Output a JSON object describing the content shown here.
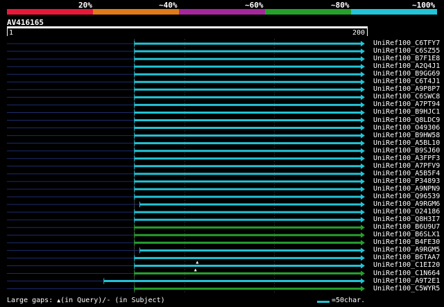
{
  "scale": {
    "colors": [
      "#e51a3a",
      "#e07b1b",
      "#a6279c",
      "#25a02c",
      "#22c4d6"
    ],
    "labels": [
      "20%",
      "~40%",
      "~60%",
      "~80%",
      "~100%"
    ]
  },
  "query": {
    "name": "AV416165",
    "range_start": "1",
    "range_end": "200"
  },
  "colors": {
    "high": "#22c4d6",
    "mid": "#25a02c",
    "guide": "#1c2d6e",
    "gridline": "#2a2a2a"
  },
  "chart_data": {
    "type": "alignment",
    "x_range": [
      1,
      200
    ],
    "hits": [
      {
        "name": "UniRef100_C6TFY7",
        "start": 72,
        "end": 200,
        "color": "high"
      },
      {
        "name": "UniRef100_C6SZ55",
        "start": 72,
        "end": 200,
        "color": "high"
      },
      {
        "name": "UniRef100_B7F1E8",
        "start": 72,
        "end": 200,
        "color": "high"
      },
      {
        "name": "UniRef100_A2Q4J1",
        "start": 72,
        "end": 200,
        "color": "high"
      },
      {
        "name": "UniRef100_B9GG69",
        "start": 72,
        "end": 200,
        "color": "high"
      },
      {
        "name": "UniRef100_C6T4J1",
        "start": 72,
        "end": 200,
        "color": "high"
      },
      {
        "name": "UniRef100_A9P8P7",
        "start": 72,
        "end": 200,
        "color": "high"
      },
      {
        "name": "UniRef100_C6SWC8",
        "start": 72,
        "end": 200,
        "color": "high"
      },
      {
        "name": "UniRef100_A7PT94",
        "start": 72,
        "end": 200,
        "color": "high"
      },
      {
        "name": "UniRef100_B9HJC1",
        "start": 72,
        "end": 200,
        "color": "high"
      },
      {
        "name": "UniRef100_Q8LDC9",
        "start": 72,
        "end": 200,
        "color": "high"
      },
      {
        "name": "UniRef100_O49306",
        "start": 72,
        "end": 200,
        "color": "high"
      },
      {
        "name": "UniRef100_B9HW58",
        "start": 72,
        "end": 200,
        "color": "high"
      },
      {
        "name": "UniRef100_A5BL10",
        "start": 72,
        "end": 200,
        "color": "high"
      },
      {
        "name": "UniRef100_B9SJ60",
        "start": 72,
        "end": 200,
        "color": "high"
      },
      {
        "name": "UniRef100_A3FPF3",
        "start": 72,
        "end": 200,
        "color": "high"
      },
      {
        "name": "UniRef100_A7PFV9",
        "start": 72,
        "end": 200,
        "color": "high"
      },
      {
        "name": "UniRef100_A5B5F4",
        "start": 72,
        "end": 200,
        "color": "high"
      },
      {
        "name": "UniRef100_P34893",
        "start": 72,
        "end": 200,
        "color": "high"
      },
      {
        "name": "UniRef100_A9NPN9",
        "start": 72,
        "end": 200,
        "color": "high"
      },
      {
        "name": "UniRef100_Q96539",
        "start": 72,
        "end": 200,
        "color": "high"
      },
      {
        "name": "UniRef100_A9RGM6",
        "start": 75,
        "end": 200,
        "color": "high"
      },
      {
        "name": "UniRef100_O24186",
        "start": 72,
        "end": 200,
        "color": "high"
      },
      {
        "name": "UniRef100_Q8H3I7",
        "start": 72,
        "end": 200,
        "color": "high"
      },
      {
        "name": "UniRef100_B6U9U7",
        "start": 72,
        "end": 200,
        "color": "mid"
      },
      {
        "name": "UniRef100_B6SLX1",
        "start": 72,
        "end": 200,
        "color": "mid"
      },
      {
        "name": "UniRef100_B4FE30",
        "start": 72,
        "end": 200,
        "color": "mid"
      },
      {
        "name": "UniRef100_A9RGM5",
        "start": 75,
        "end": 200,
        "color": "high"
      },
      {
        "name": "UniRef100_B6TAA7",
        "start": 72,
        "end": 200,
        "color": "high"
      },
      {
        "name": "UniRef100_C1EI20",
        "start": 72,
        "end": 200,
        "color": "high",
        "gap_query": 107
      },
      {
        "name": "UniRef100_C1N664",
        "start": 72,
        "end": 200,
        "color": "mid",
        "gap_query": 106
      },
      {
        "name": "UniRef100_A9T2E1",
        "start": 55,
        "end": 200,
        "color": "high"
      },
      {
        "name": "UniRef100_C5WYR5",
        "start": 72,
        "end": 200,
        "color": "mid"
      }
    ]
  },
  "footer": {
    "gaps_prefix": "Large gaps:",
    "gaps_marker": "▲",
    "gaps_suffix": "(in Query)/- (in Subject)",
    "legend_text": "=50char."
  }
}
